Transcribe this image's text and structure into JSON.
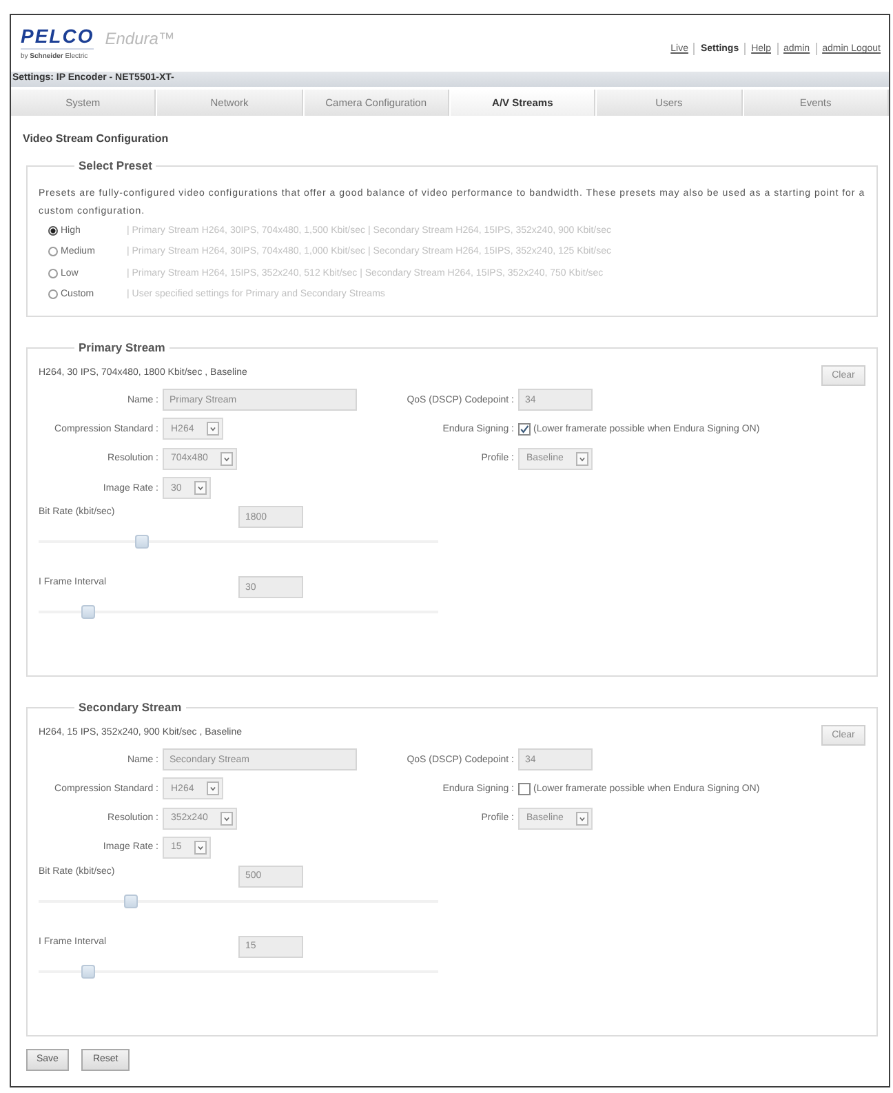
{
  "header": {
    "logo": "PELCO",
    "logo_tagline": "by **Schneider** Electric",
    "product": "Endura™",
    "links": [
      {
        "label": "Live",
        "selected": false
      },
      {
        "label": "Settings",
        "selected": true
      },
      {
        "label": "Help",
        "selected": false
      },
      {
        "label": "admin",
        "selected": false
      },
      {
        "label": "admin Logout",
        "selected": false
      }
    ]
  },
  "breadcrumb": "Settings: IP Encoder - NET5501-XT-",
  "tabs": [
    {
      "label": "System",
      "selected": false
    },
    {
      "label": "Network",
      "selected": false
    },
    {
      "label": "Camera Configuration",
      "selected": false
    },
    {
      "label": "A/V Streams",
      "selected": true
    },
    {
      "label": "Users",
      "selected": false
    },
    {
      "label": "Events",
      "selected": false
    }
  ],
  "page_title": "Video Stream Configuration",
  "preset": {
    "legend": "Select Preset",
    "description": "Presets are fully-configured video configurations that offer a good balance of video performance to bandwidth. These presets may also be used as a starting point for a custom configuration.",
    "options": [
      {
        "label": "High",
        "detail": "| Primary Stream H264, 30IPS, 704x480, 1,500 Kbit/sec | Secondary Stream H264, 15IPS, 352x240, 900 Kbit/sec",
        "selected": true
      },
      {
        "label": "Medium",
        "detail": "| Primary Stream H264, 30IPS, 704x480, 1,000 Kbit/sec | Secondary Stream H264, 15IPS, 352x240, 125 Kbit/sec",
        "selected": false
      },
      {
        "label": "Low",
        "detail": "| Primary Stream H264, 15IPS, 352x240, 512 Kbit/sec | Secondary Stream H264, 15IPS, 352x240, 750 Kbit/sec",
        "selected": false
      },
      {
        "label": "Custom",
        "detail": "| User specified settings for Primary and Secondary Streams",
        "selected": false
      }
    ]
  },
  "streams": [
    {
      "legend": "Primary Stream",
      "summary": "H264, 30 IPS, 704x480, 1800 Kbit/sec , Baseline",
      "clear_button": "Clear",
      "fields": [
        {
          "kind": "text",
          "label": "Name :",
          "value": "Primary Stream"
        },
        {
          "kind": "text",
          "label": "QoS (DSCP) Codepoint :",
          "value": "34"
        },
        {
          "kind": "select",
          "label": "Compression Standard :",
          "value": "H264"
        },
        {
          "kind": "checkbox",
          "label": "Endura Signing :",
          "checked": true,
          "note": "(Lower framerate possible when Endura Signing ON)"
        },
        {
          "kind": "select",
          "label": "Resolution :",
          "value": "704x480"
        },
        {
          "kind": "select",
          "label": "Profile :",
          "value": "Baseline"
        },
        {
          "kind": "select",
          "label": "Image Rate :",
          "value": "30"
        }
      ],
      "sliders": [
        {
          "label": "Bit Rate (kbit/sec)",
          "value": "1800",
          "level": 0.25
        },
        {
          "label": "I Frame Interval",
          "value": "30",
          "level": 0.11
        }
      ]
    },
    {
      "legend": "Secondary Stream",
      "summary": "H264, 15 IPS, 352x240, 900 Kbit/sec , Baseline",
      "clear_button": "Clear",
      "fields": [
        {
          "kind": "text",
          "label": "Name :",
          "value": "Secondary Stream"
        },
        {
          "kind": "text",
          "label": "QoS (DSCP) Codepoint :",
          "value": "34"
        },
        {
          "kind": "select",
          "label": "Compression Standard :",
          "value": "H264"
        },
        {
          "kind": "checkbox",
          "label": "Endura Signing :",
          "checked": false,
          "note": "(Lower framerate possible when Endura Signing ON)"
        },
        {
          "kind": "select",
          "label": "Resolution :",
          "value": "352x240"
        },
        {
          "kind": "select",
          "label": "Profile :",
          "value": "Baseline"
        },
        {
          "kind": "select",
          "label": "Image Rate :",
          "value": "15"
        }
      ],
      "sliders": [
        {
          "label": "Bit Rate (kbit/sec)",
          "value": "500",
          "level": 0.22
        },
        {
          "label": "I Frame Interval",
          "value": "15",
          "level": 0.11
        }
      ]
    }
  ],
  "buttons": [
    "Save",
    "Reset"
  ]
}
